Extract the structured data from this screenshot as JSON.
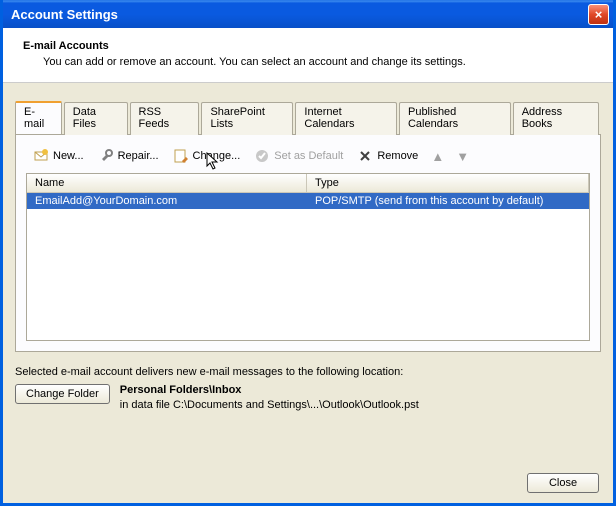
{
  "window": {
    "title": "Account Settings",
    "close_glyph": "×"
  },
  "header": {
    "title": "E-mail Accounts",
    "subtitle": "You can add or remove an account. You can select an account and change its settings."
  },
  "tabs": [
    {
      "label": "E-mail",
      "active": true
    },
    {
      "label": "Data Files"
    },
    {
      "label": "RSS Feeds"
    },
    {
      "label": "SharePoint Lists"
    },
    {
      "label": "Internet Calendars"
    },
    {
      "label": "Published Calendars"
    },
    {
      "label": "Address Books"
    }
  ],
  "toolbar": {
    "new_label": "New...",
    "repair_label": "Repair...",
    "change_label": "Change...",
    "set_default_label": "Set as Default",
    "remove_label": "Remove"
  },
  "grid": {
    "cols": {
      "name": "Name",
      "type": "Type"
    },
    "rows": [
      {
        "name": "EmailAdd@YourDomain.com",
        "type": "POP/SMTP (send from this account by default)"
      }
    ]
  },
  "footer": {
    "delivers_label": "Selected e-mail account delivers new e-mail messages to the following location:",
    "change_folder_label": "Change Folder",
    "folder_path": "Personal Folders\\Inbox",
    "datafile_line": "in data file C:\\Documents and Settings\\...\\Outlook\\Outlook.pst"
  },
  "buttons": {
    "close": "Close"
  }
}
